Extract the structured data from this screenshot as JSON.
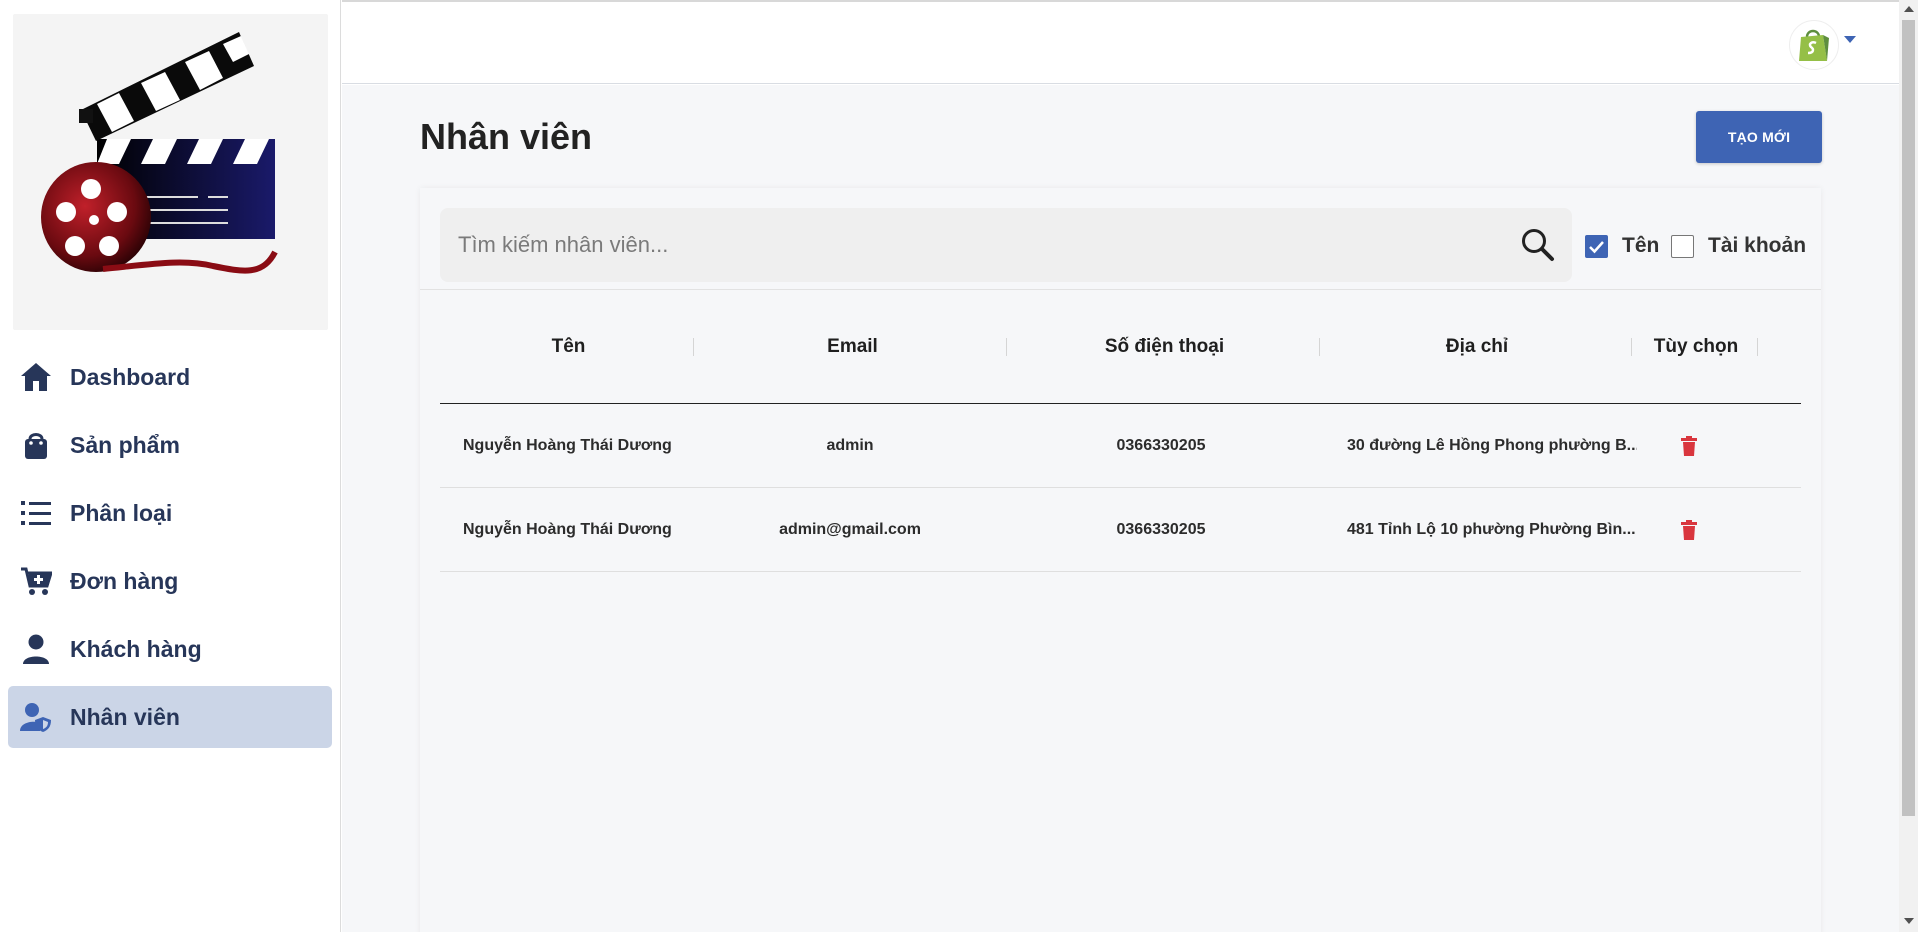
{
  "nav": {
    "items": [
      {
        "label": "Dashboard",
        "icon": "home-icon",
        "active": false
      },
      {
        "label": "Sản phẩm",
        "icon": "shopping-bag-icon",
        "active": false
      },
      {
        "label": "Phân loại",
        "icon": "list-icon",
        "active": false
      },
      {
        "label": "Đơn hàng",
        "icon": "cart-plus-icon",
        "active": false
      },
      {
        "label": "Khách hàng",
        "icon": "person-icon",
        "active": false
      },
      {
        "label": "Nhân viên",
        "icon": "person-shield-icon",
        "active": true
      }
    ]
  },
  "header": {
    "avatar_icon": "shopify-bag-icon"
  },
  "page": {
    "title": "Nhân viên",
    "create_label": "TẠO MỚI"
  },
  "search": {
    "placeholder": "Tìm kiếm nhân viên...",
    "value": "",
    "filters": [
      {
        "label": "Tên",
        "checked": true
      },
      {
        "label": "Tài khoản",
        "checked": false
      }
    ]
  },
  "table": {
    "columns": [
      "Tên",
      "Email",
      "Số điện thoại",
      "Địa chỉ",
      "Tùy chọn"
    ],
    "rows": [
      {
        "name": "Nguyễn Hoàng Thái Dương",
        "email": "admin",
        "phone": "0366330205",
        "address": "30 đường Lê Hồng Phong phường B..."
      },
      {
        "name": "Nguyễn Hoàng Thái Dương",
        "email": "admin@gmail.com",
        "phone": "0366330205",
        "address": "481 Tỉnh Lộ 10 phường Phường Bìn..."
      }
    ]
  },
  "colors": {
    "primary": "#3e64b4",
    "nav_text": "#273659",
    "nav_active_bg": "#cbd5e7",
    "delete": "#d9363e"
  }
}
